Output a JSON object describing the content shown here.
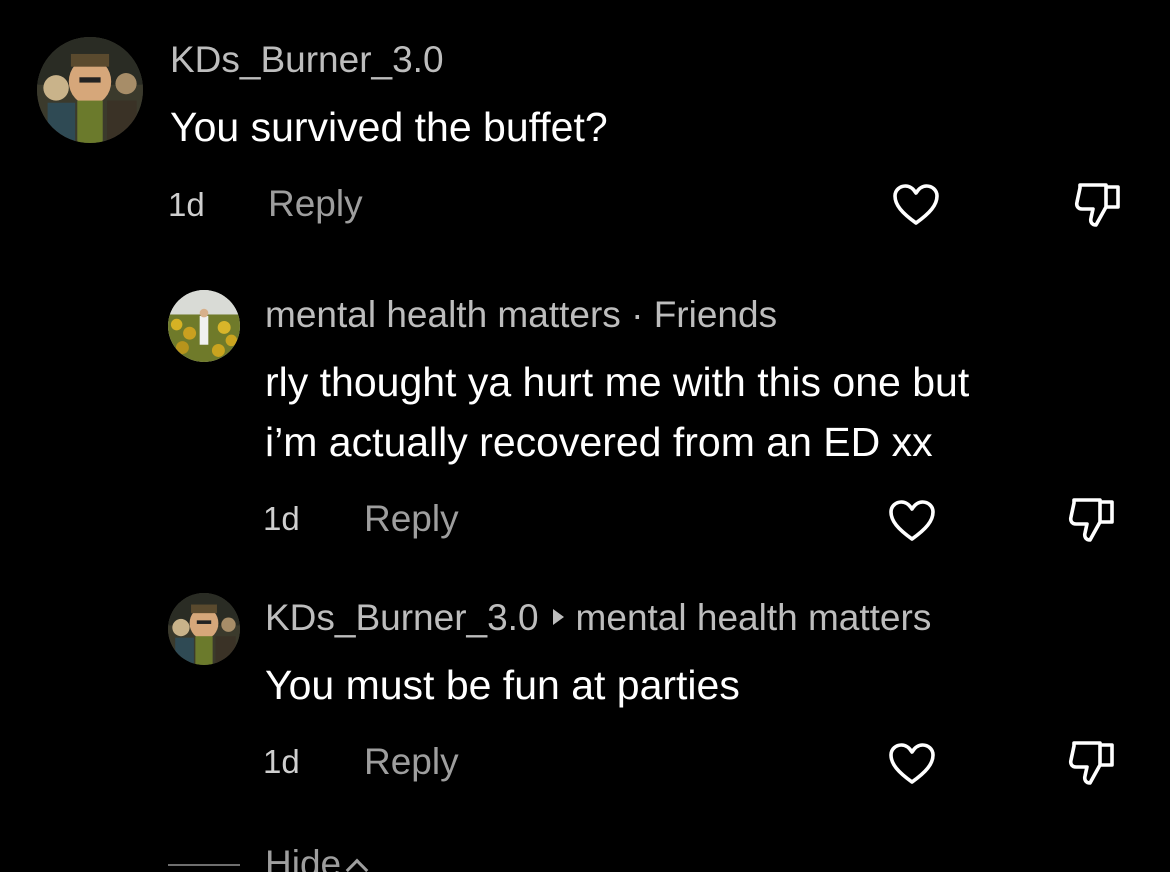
{
  "comments": [
    {
      "username": "KDs_Burner_3.0",
      "text": "You survived the buffet?",
      "time": "1d",
      "reply_label": "Reply"
    },
    {
      "username": "mental health matters",
      "separator": "·",
      "relationship": "Friends",
      "text_line1": "rly thought ya hurt me with this one but",
      "text_line2": "i’m actually recovered from an ED xx",
      "time": "1d",
      "reply_label": "Reply"
    },
    {
      "username": "KDs_Burner_3.0",
      "reply_to": "mental health matters",
      "text": "You must be fun at parties",
      "time": "1d",
      "reply_label": "Reply"
    }
  ],
  "hide_label": "Hide",
  "icons": {
    "like": "heart-outline-icon",
    "dislike": "thumbs-down-icon",
    "reply_arrow": "triangle-right-icon",
    "collapse": "chevron-up-icon"
  },
  "colors": {
    "background": "#000000",
    "text": "#ffffff",
    "username": "#bdbdbd",
    "muted": "#9e9e9e"
  }
}
